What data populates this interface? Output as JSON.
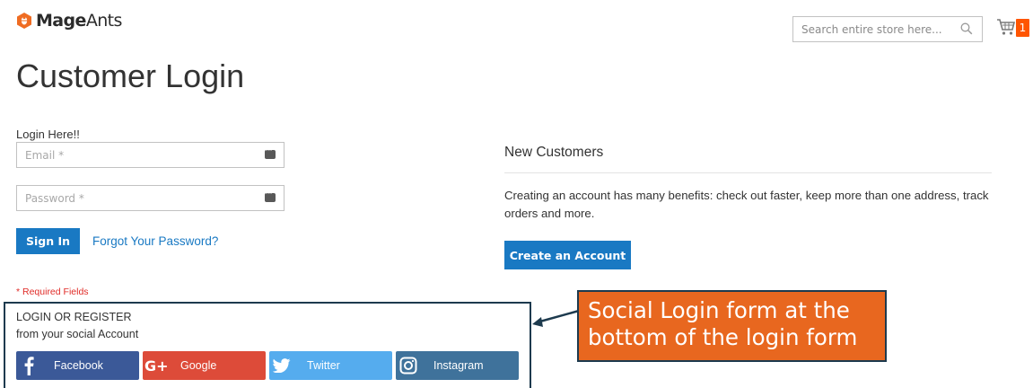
{
  "header": {
    "logo_bold": "Mage",
    "logo_regular": "Ants",
    "search_placeholder": "Search entire store here...",
    "cart_count": "1"
  },
  "page": {
    "title": "Customer Login"
  },
  "login_form": {
    "heading": "Login Here!!",
    "email_placeholder": "Email *",
    "password_placeholder": "Password *",
    "sign_in_label": "Sign In",
    "forgot_password_label": "Forgot Your Password?",
    "required_note": "* Required Fields"
  },
  "social_login": {
    "title": "LOGIN OR REGISTER",
    "subtitle": "from your social Account",
    "buttons": [
      {
        "label": "Facebook",
        "icon": "facebook-icon",
        "color": "#3b5998"
      },
      {
        "label": "Google",
        "icon": "google-plus-icon",
        "color": "#dd4b39"
      },
      {
        "label": "Twitter",
        "icon": "twitter-icon",
        "color": "#55acee"
      },
      {
        "label": "Instagram",
        "icon": "instagram-icon",
        "color": "#3f729b"
      }
    ]
  },
  "new_customers": {
    "title": "New Customers",
    "description": "Creating an account has many benefits: check out faster, keep more than one address, track orders and more.",
    "create_label": "Create an Account"
  },
  "annotation": {
    "line1": "Social Login form at the",
    "line2": "bottom of the login form"
  },
  "colors": {
    "primary": "#1979c3",
    "cart_badge": "#ff5501",
    "callout": "#e8671f",
    "required": "#e02b27"
  }
}
